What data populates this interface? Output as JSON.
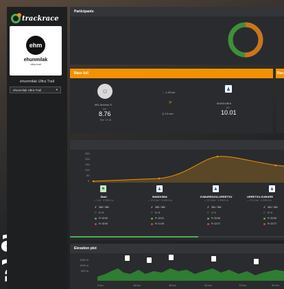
{
  "background": {
    "word_1": "ace",
    "word_2": "?"
  },
  "sidebar": {
    "logo_text": "trackrace",
    "event_logo": {
      "circle_text": "ehm",
      "name": "ehunmilak",
      "sub": "ultra trail"
    },
    "event_title": "ehunmilak Ultra Trail",
    "select_value": "ehunmilak Ultra Trail"
  },
  "participants_card": {
    "title": "Participants"
  },
  "race_card": {
    "title": "Race full",
    "title_2": "Race",
    "runner_name": "#81 Antonio S.",
    "rank_label": "km",
    "rank_value": "8.76",
    "pace": "Rim 17:18",
    "delta_distance": "→ 1.25 km",
    "delta_time": "12 min",
    "next_point": "MANDUBIA",
    "next_label": "km",
    "next_value": "10.01"
  },
  "profile_card": {
    "y_ticks": [
      "250",
      "200",
      "150",
      "100",
      "50",
      "0"
    ],
    "points": [
      {
        "name": "Start",
        "dist": "— 0 m · 4 190.0 m",
        "runners": "385 / 385",
        "flag": "0 / 0",
        "open": "Fr 10:00",
        "close": "Fr 10:00"
      },
      {
        "name": "MANDUBIA",
        "dist": "— 10.1 km · 4 245.0 m",
        "runners": "385 / 385",
        "flag": "0 / 0",
        "open": "Fr 19:01",
        "close": "Fr 21:39"
      },
      {
        "name": "ZUMARRAGA-URRETXU",
        "dist": "— 21.1 km · 4 245.0 m",
        "runners": "384 / 384",
        "flag": "1 / 1",
        "open": "Fr 20:06",
        "close": "Fr 22:27"
      },
      {
        "name": "URRETXU-ZUMARR",
        "dist": "— 21.1 km · 4 245.0 m",
        "runners": "384 / 384",
        "flag": "0 / 1",
        "open": "Fr 20:06",
        "close": "Fr 22:27"
      }
    ]
  },
  "elevation_card": {
    "title": "Elevation plot",
    "y_ticks": [
      "1500 m",
      "1000 m",
      "500 m"
    ],
    "x_ticks": [
      "0 km",
      "18 km",
      "36 km",
      "54 km",
      "72 km",
      "90 km"
    ]
  },
  "colors": {
    "accent": "#f39200",
    "green": "#4caf50",
    "card": "#2a2b2e"
  }
}
